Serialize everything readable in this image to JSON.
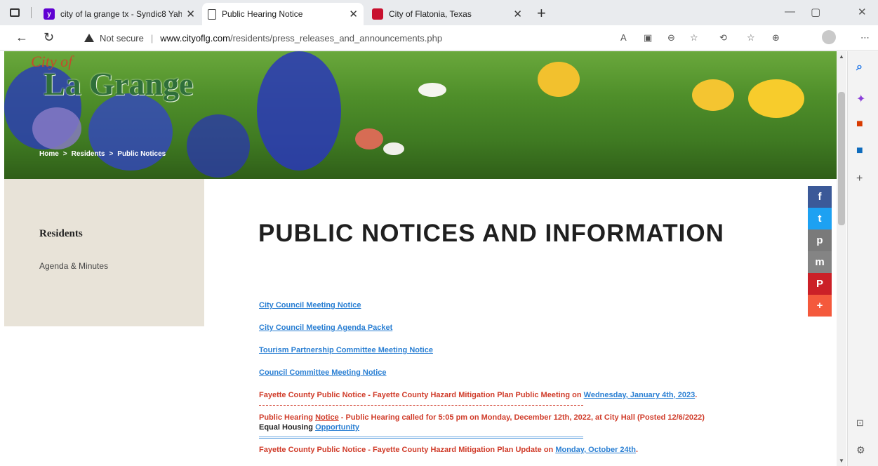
{
  "browser": {
    "tabs": [
      {
        "title": "city of la grange tx - Syndic8 Yah",
        "favicon": "yahoo-icon"
      },
      {
        "title": "Public Hearing Notice",
        "favicon": "document-icon",
        "active": true
      },
      {
        "title": "City of Flatonia, Texas",
        "favicon": "flatonia-icon"
      }
    ],
    "new_tab": "+",
    "security_label": "Not secure",
    "url_host": "www.cityoflg.com",
    "url_path": "/residents/press_releases_and_announcements.php"
  },
  "hero": {
    "logo_small": "City of",
    "logo": "La Grange",
    "breadcrumbs": [
      "Home",
      ">",
      "Residents",
      ">",
      "Public Notices"
    ]
  },
  "sidebar": {
    "heading": "Residents",
    "links": [
      "Agenda & Minutes"
    ]
  },
  "page": {
    "title": "PUBLIC NOTICES AND INFORMATION"
  },
  "notices": {
    "link1": "City Council Meeting Notice",
    "link2": "City Council Meeting Agenda Packet",
    "link3": "Tourism Partnership Committee Meeting  Notice",
    "link4": "Council Committee Meeting Notice",
    "item5_text": "Fayette County Public Notice - Fayette County Hazard Mitigation Plan Public Meeting on ",
    "item5_link": "Wednesday, January 4th, 2023",
    "item5_end": ".",
    "item6_pre": "Public Hearing ",
    "item6_link": "Notice",
    "item6_text": " - Public Hearing called for 5:05 pm on Monday, December 12th, 2022, at City Hall (Posted 12/6/2022)",
    "item7_text": "Equal Housing ",
    "item7_link": "Opportunity",
    "item8_text": "Fayette County Public Notice - Fayette County Hazard Mitigation Plan Update on ",
    "item8_link": "Monday, October 24th",
    "item8_end": "."
  },
  "share": [
    "f",
    "t",
    "p",
    "m",
    "P",
    "+"
  ],
  "colors": {
    "link_blue": "#2a7fd3",
    "notice_red": "#d03c2a",
    "sidebar_bg": "#e8e3d8"
  }
}
